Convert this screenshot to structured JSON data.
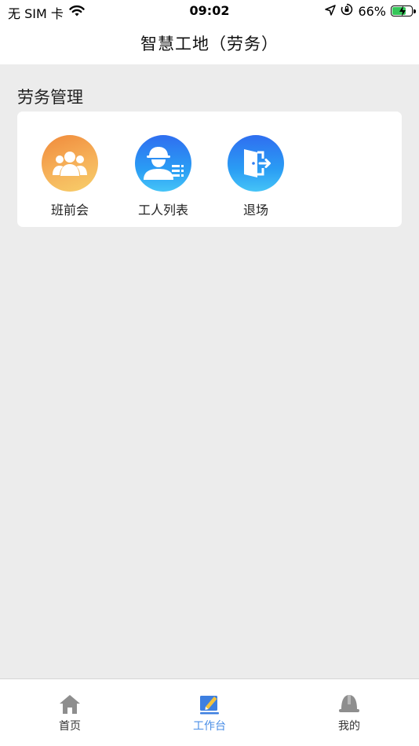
{
  "status_bar": {
    "carrier": "无 SIM 卡",
    "time": "09:02",
    "battery_percent": "66%",
    "battery_level": 0.66
  },
  "header": {
    "title": "智慧工地（劳务）"
  },
  "section": {
    "title": "劳务管理",
    "items": [
      {
        "label": "班前会",
        "icon": "meeting-group-icon",
        "color": "#f39a3f"
      },
      {
        "label": "工人列表",
        "icon": "worker-list-icon",
        "color": "#2f7df2"
      },
      {
        "label": "退场",
        "icon": "exit-door-icon",
        "color": "#2f7df2"
      }
    ]
  },
  "tab_bar": {
    "active_color": "#4a8ee6",
    "tabs": [
      {
        "label": "首页",
        "icon": "home-icon",
        "active": false
      },
      {
        "label": "工作台",
        "icon": "workbench-icon",
        "active": true
      },
      {
        "label": "我的",
        "icon": "profile-helmet-icon",
        "active": false
      }
    ]
  }
}
